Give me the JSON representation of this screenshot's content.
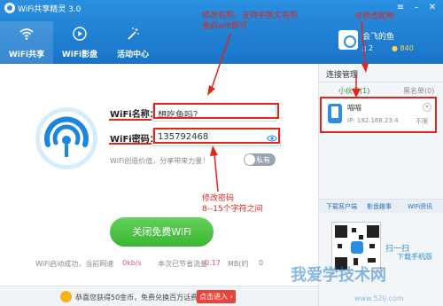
{
  "app": {
    "title": "WiFi共享精灵 3.0"
  },
  "nav": {
    "tabs": [
      {
        "label": "WiFi共享",
        "icon": "wifi-icon"
      },
      {
        "label": "WiFi影盘",
        "icon": "play-icon"
      },
      {
        "label": "活动中心",
        "icon": "magic-wand-icon"
      }
    ]
  },
  "profile": {
    "name": "会飞的鱼",
    "phones": "2",
    "money": "840"
  },
  "form": {
    "name_label": "WiFi名称：",
    "name_value": "想吃鱼吗？",
    "password_label": "WiFi密码：",
    "password_value": "135792468",
    "tip": "WiFi创造价值，分享带来力量！",
    "toggle_label": "私有"
  },
  "start_button": "关闭免费WiFi",
  "stats": {
    "prefix": "WiFi启动成功，当前网速",
    "speed": "0kb/s",
    "traffic_label": "本次已节省流量",
    "traffic": "0.17",
    "traffic_unit": "MB(约",
    "more": "0"
  },
  "footer": {
    "text": "恭喜您获得50金币，免费兑换百万话费。",
    "button": "点击进入 ›"
  },
  "side": {
    "title": "连接管理",
    "tab_active": "小伙伴(1)",
    "tab_black": "黑名单(0)",
    "device_name": "喵喵",
    "device_ip": "IP: 192.168.23.4",
    "device_tag": "不限",
    "bottom_tabs": [
      "下载客户端",
      "影盘趣事",
      "WiFi资讯"
    ],
    "scan_text": "扫一扫",
    "download_text": "下载手机版"
  },
  "annotations": {
    "rename_line1": "修改名称，支持中英文名称",
    "rename_line2": "重启wifi即可",
    "nickname": "可修改昵称",
    "password_line1": "修改密码",
    "password_line2": "8--15个字符之间"
  },
  "watermark": {
    "text": "我爱学技术网",
    "url": "www.52ij.com"
  },
  "colors": {
    "header": "#1a74c7",
    "accent": "#2a8fe0",
    "green": "#3db433",
    "annotation": "#e0251b"
  }
}
